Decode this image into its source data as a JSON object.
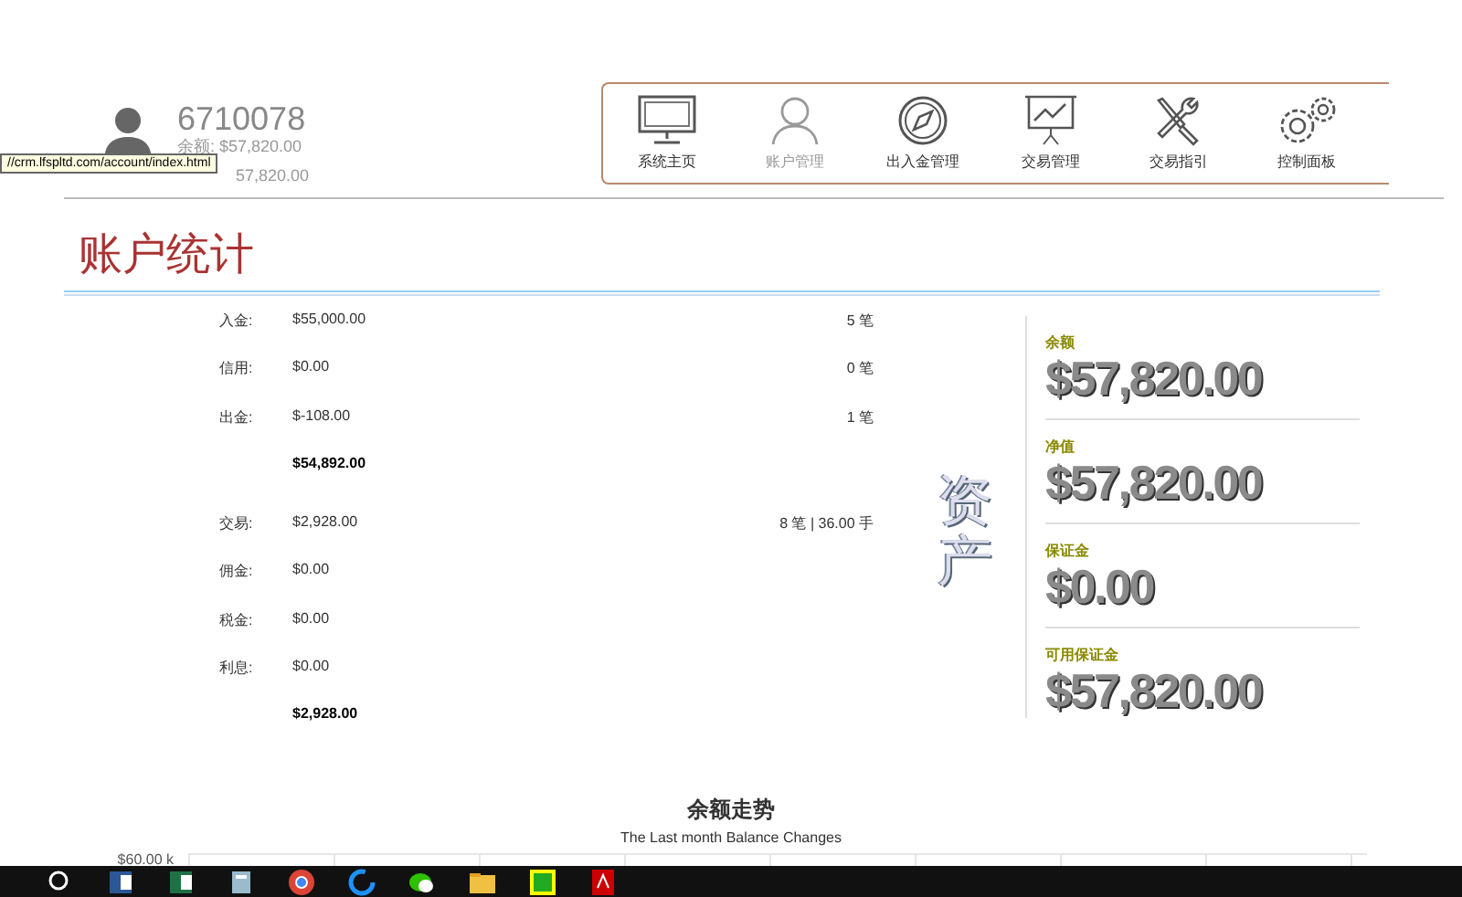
{
  "account": {
    "number": "6710078",
    "balance_label": "余额:",
    "balance": "$57,820.00",
    "second_line": "57,820.00"
  },
  "tooltip": {
    "text": "//crm.lfspltd.com/account/index.html"
  },
  "nav": [
    {
      "label": "系统主页",
      "kind": "monitor",
      "selected": false
    },
    {
      "label": "账户管理",
      "kind": "person",
      "selected": true
    },
    {
      "label": "出入金管理",
      "kind": "compass",
      "selected": false
    },
    {
      "label": "交易管理",
      "kind": "chart",
      "selected": false
    },
    {
      "label": "交易指引",
      "kind": "tools",
      "selected": false
    },
    {
      "label": "控制面板",
      "kind": "gears",
      "selected": false
    }
  ],
  "page_title": "账户统计",
  "stats": [
    {
      "kind": "item",
      "label": "入金:",
      "value": "$55,000.00",
      "count": "5 笔"
    },
    {
      "kind": "item",
      "label": "信用:",
      "value": "$0.00",
      "count": "0 笔"
    },
    {
      "kind": "item",
      "label": "出金:",
      "value": "$-108.00",
      "count": "1 笔"
    },
    {
      "kind": "total",
      "value": "$54,892.00"
    },
    {
      "kind": "item",
      "label": "交易:",
      "value": "$2,928.00",
      "count": "8 笔 | 36.00 手"
    },
    {
      "kind": "item",
      "label": "佣金:",
      "value": "$0.00"
    },
    {
      "kind": "item",
      "label": "税金:",
      "value": "$0.00"
    },
    {
      "kind": "item",
      "label": "利息:",
      "value": "$0.00"
    },
    {
      "kind": "total",
      "value": "$2,928.00"
    }
  ],
  "assets_heading": "资产",
  "summary": [
    {
      "label": "余额",
      "value": "$57,820.00"
    },
    {
      "label": "净值",
      "value": "$57,820.00"
    },
    {
      "label": "保证金",
      "value": "$0.00"
    },
    {
      "label": "可用保证金",
      "value": "$57,820.00"
    }
  ],
  "chart": {
    "title": "余额走势",
    "subtitle": "The Last month Balance Changes",
    "y_tick": "$60.00 k"
  }
}
